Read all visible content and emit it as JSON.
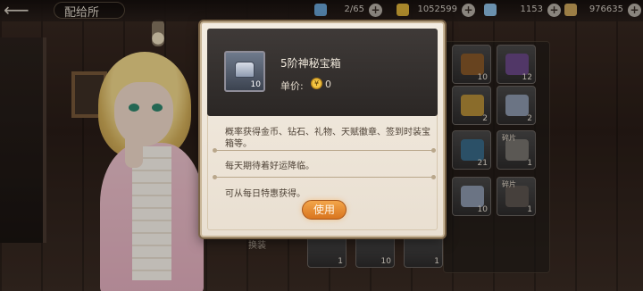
{
  "topbar": {
    "back_symbol": "⟵",
    "title": "配给所",
    "resources": [
      {
        "icon": "energy-icon",
        "value": "2/65",
        "color": "#6aa6d9"
      },
      {
        "icon": "gold-coin-icon",
        "value": "1052599",
        "color": "#e1b43a"
      },
      {
        "icon": "gem-icon",
        "value": "1153",
        "color": "#8fc2e8"
      },
      {
        "icon": "feather-icon",
        "value": "976635",
        "color": "#d1a95c"
      }
    ]
  },
  "popup": {
    "item_name": "5阶神秘宝箱",
    "item_count": "10",
    "price_label": "单价:",
    "price_coin": "¥",
    "price_value": "0",
    "description": "概率获得金币、钻石、礼物、天赋徽章、签到时装宝箱等。",
    "flavor": "每天期待着好运降临。",
    "source": "可从每日特惠获得。",
    "use_button": "使用"
  },
  "inventory": {
    "slots": [
      {
        "count": "10",
        "tag": "",
        "color": "#8a5a2a"
      },
      {
        "count": "12",
        "tag": "",
        "color": "#6d4a8a"
      },
      {
        "count": "2",
        "tag": "",
        "color": "#b8913a"
      },
      {
        "count": "2",
        "tag": "",
        "color": "#8f9bb0"
      },
      {
        "count": "21",
        "tag": "",
        "color": "#3a6b8a"
      },
      {
        "count": "1",
        "tag": "碎片",
        "color": "#7a7670"
      },
      {
        "count": "10",
        "tag": "",
        "color": "#8f9bb0"
      },
      {
        "count": "1",
        "tag": "碎片",
        "color": "#5e5650"
      }
    ],
    "bottom_slots": [
      {
        "count": "1"
      },
      {
        "count": "10"
      },
      {
        "count": "1"
      }
    ],
    "bottom_label": "换装"
  }
}
